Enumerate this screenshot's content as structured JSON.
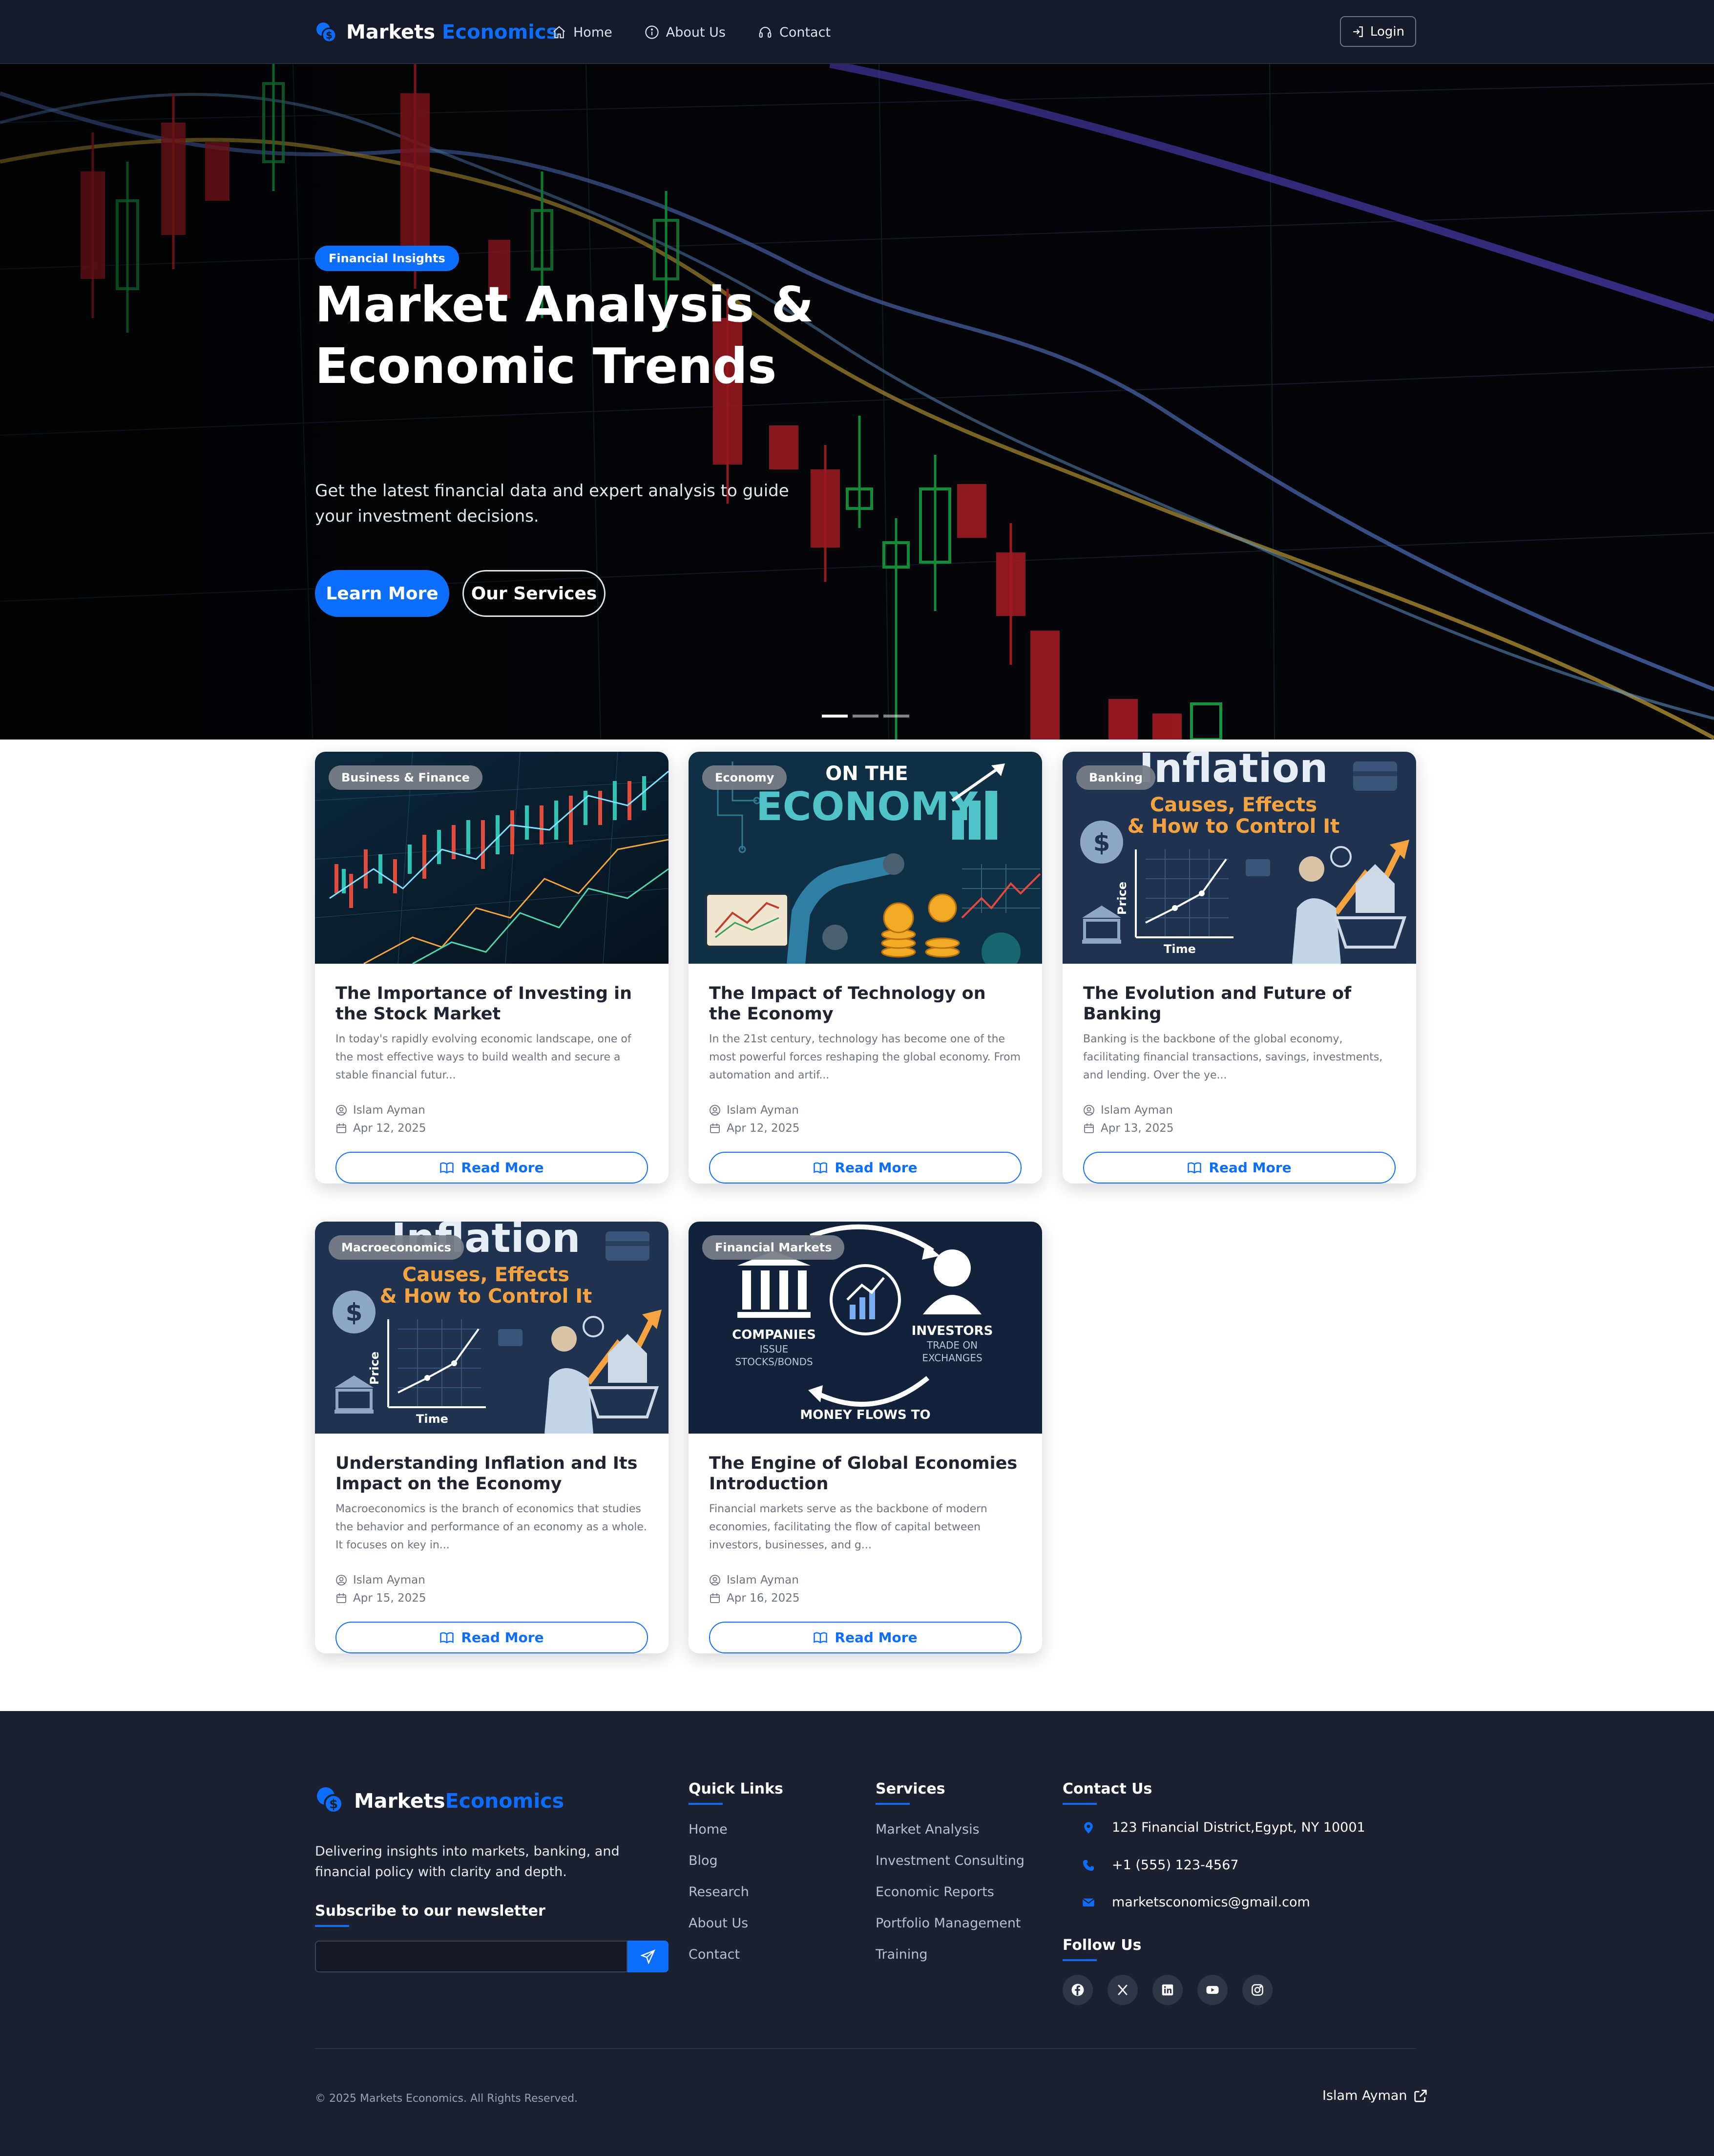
{
  "nav": {
    "brand_part1": "Markets",
    "brand_part2": "Economics",
    "links": [
      {
        "label": "Home",
        "icon": "home-icon"
      },
      {
        "label": "About Us",
        "icon": "info-icon"
      },
      {
        "label": "Contact",
        "icon": "headset-icon"
      }
    ],
    "login_label": "Login"
  },
  "hero": {
    "badge": "Financial Insights",
    "title": "Market Analysis & Economic Trends",
    "subtitle": "Get the latest financial data and expert analysis to guide your investment decisions.",
    "primary_button": "Learn More",
    "secondary_button": "Our Services",
    "slide_count": 3,
    "active_slide": 1
  },
  "cards": [
    {
      "category": "Business & Finance",
      "title": "The Importance of Investing in the Stock Market",
      "excerpt": "In today's rapidly evolving economic landscape, one of the most effective ways to build wealth and secure a stable financial futur...",
      "author": "Islam Ayman",
      "date": "Apr 12, 2025",
      "button": "Read More",
      "image_text": []
    },
    {
      "category": "Economy",
      "title": "The Impact of Technology on the Economy",
      "excerpt": "In the 21st century, technology has become one of the most powerful forces reshaping the global economy. From automation and artif...",
      "author": "Islam Ayman",
      "date": "Apr 12, 2025",
      "button": "Read More",
      "image_text": [
        "ON THE",
        "ECONOMY"
      ]
    },
    {
      "category": "Banking",
      "title": "The Evolution and Future of Banking",
      "excerpt": "Banking is the backbone of the global economy, facilitating financial transactions, savings, investments, and lending. Over the ye...",
      "author": "Islam Ayman",
      "date": "Apr 13, 2025",
      "button": "Read More",
      "image_text": [
        "Inflation",
        "Causes, Effects",
        "& How to Control It",
        "Price",
        "Time"
      ]
    },
    {
      "category": "Macroeconomics",
      "title": "Understanding Inflation and Its Impact on the Economy",
      "excerpt": "Macroeconomics is the branch of economics that studies the behavior and performance of an economy as a whole. It focuses on key in...",
      "author": "Islam Ayman",
      "date": "Apr 15, 2025",
      "button": "Read More",
      "image_text": [
        "Inflation",
        "Causes, Effects",
        "& How to Control It",
        "Price",
        "Time"
      ]
    },
    {
      "category": "Financial Markets",
      "title": "The Engine of Global Economies Introduction",
      "excerpt": "Financial markets serve as the backbone of modern economies, facilitating the flow of capital between investors, businesses, and g...",
      "author": "Islam Ayman",
      "date": "Apr 16, 2025",
      "button": "Read More",
      "image_text": [
        "COMPANIES",
        "ISSUE",
        "STOCKS/BONDS",
        "INVESTORS",
        "TRADE ON",
        "EXCHANGES",
        "MONEY FLOWS TO"
      ]
    }
  ],
  "footer": {
    "brand_part1": "Markets",
    "brand_part2": "Economics",
    "description": "Delivering insights into markets, banking, and financial policy with clarity and depth.",
    "newsletter_heading": "Subscribe to our newsletter",
    "newsletter_value": "",
    "quick_links_heading": "Quick Links",
    "quick_links": [
      "Home",
      "Blog",
      "Research",
      "About Us",
      "Contact"
    ],
    "services_heading": "Services",
    "services": [
      "Market Analysis",
      "Investment Consulting",
      "Economic Reports",
      "Portfolio Management",
      "Training"
    ],
    "contact_heading": "Contact Us",
    "contact": {
      "address": "123 Financial District,Egypt, NY 10001",
      "phone": "+1 (555) 123-4567",
      "email": "marketsconomics@gmail.com"
    },
    "follow_heading": "Follow Us",
    "socials": [
      "facebook-icon",
      "x-icon",
      "linkedin-icon",
      "youtube-icon",
      "instagram-icon"
    ],
    "copyright": "© 2025 Markets Economics. All Rights Reserved.",
    "credit": "Islam Ayman"
  },
  "colors": {
    "accent": "#0d6efd",
    "navbar_bg": "#151b2b",
    "footer_bg": "#1b2130"
  }
}
